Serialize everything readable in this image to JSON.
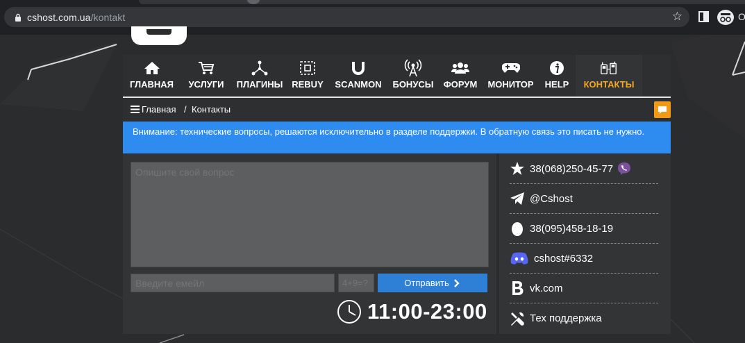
{
  "browser": {
    "url_domain": "cshost.com.ua",
    "url_path": "/kontakt",
    "profile_label": "O"
  },
  "nav": {
    "items": [
      {
        "label": "ГЛАВНАЯ",
        "icon": "home-icon"
      },
      {
        "label": "УСЛУГИ",
        "icon": "cart-icon"
      },
      {
        "label": "ПЛАГИНЫ",
        "icon": "network-icon"
      },
      {
        "label": "REBUY",
        "icon": "rebuy-icon"
      },
      {
        "label": "SCANMON",
        "icon": "magnet-icon"
      },
      {
        "label": "БОНУСЫ",
        "icon": "antenna-icon"
      },
      {
        "label": "ФОРУМ",
        "icon": "users-icon"
      },
      {
        "label": "МОНИТОР",
        "icon": "gamepad-icon"
      },
      {
        "label": "HELP",
        "icon": "info-icon"
      },
      {
        "label": "КОНТАКТЫ",
        "icon": "phones-icon",
        "active": true
      }
    ],
    "active_color": "#f5a623"
  },
  "breadcrumb": {
    "home": "Главная",
    "separator": "/",
    "current": "Контакты"
  },
  "notice": {
    "text": "Внимание: технические вопросы, решаются исключительно в разделе поддержки. В обратную связь это писать не нужно."
  },
  "form": {
    "question_placeholder": "Опишите свой вопрос",
    "email_placeholder": "Введите емейл",
    "captcha_placeholder": "4+9=?",
    "send_label": "Отправить",
    "hours": "11:00-23:00"
  },
  "contacts": [
    {
      "icon": "star-icon",
      "text": "38(068)250-45-77",
      "extra_icon": "viber-icon"
    },
    {
      "icon": "telegram-icon",
      "text": "@Cshost"
    },
    {
      "icon": "icq-egg-icon",
      "text": "38(095)458-18-19"
    },
    {
      "icon": "discord-icon",
      "text": "cshost#6332"
    },
    {
      "icon": "vk-icon",
      "text": "vk.com"
    },
    {
      "icon": "tools-icon",
      "text": "Тех поддержка"
    }
  ],
  "colors": {
    "notice_bg": "#2e8cf0",
    "send_bg": "#2e7fd6",
    "chat_btn": "#f29a16",
    "page_bg": "#2b2c2e"
  }
}
